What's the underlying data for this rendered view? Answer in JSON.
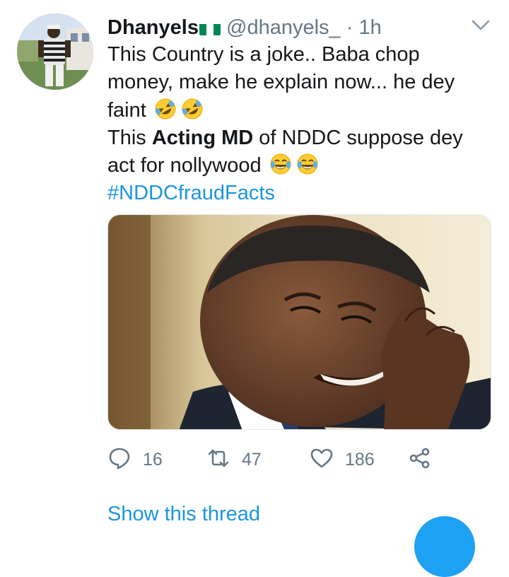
{
  "tweet": {
    "display_name": "Dhanyels",
    "flag_icon": "nigeria-flag-icon",
    "handle": "@dhanyels_",
    "separator": "·",
    "time": "1h",
    "line1": "This Country is a joke.. Baba chop money, make he explain now... he dey faint",
    "line2_pre": "This ",
    "line2_bold": "Acting MD",
    "line2_post": " of NDDC suppose dey act for nollywood",
    "hashtag": "#NDDCfraudFacts",
    "emojis_line1": [
      "rolling-on-floor-laughing-icon",
      "rolling-on-floor-laughing-icon"
    ],
    "emojis_line2": [
      "face-with-tears-of-joy-icon",
      "face-with-tears-of-joy-icon"
    ]
  },
  "actions": {
    "reply_count": "16",
    "retweet_count": "47",
    "like_count": "186"
  },
  "show_thread": "Show this thread",
  "colors": {
    "link": "#1b95e0",
    "secondary_text": "#657786",
    "primary_text": "#14171a",
    "fab": "#1da1f2"
  }
}
